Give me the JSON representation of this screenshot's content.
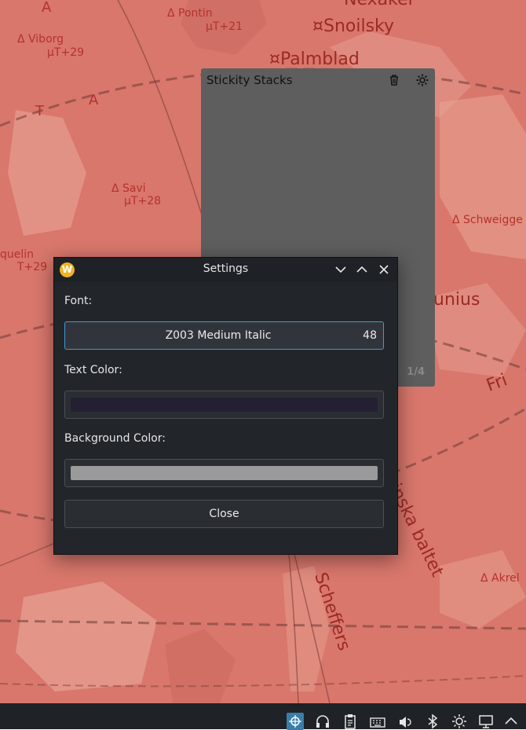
{
  "wallpaper": {
    "labels": [
      {
        "text": "A",
        "key": "a1"
      },
      {
        "text": "Δ Pontin",
        "key": "pontin"
      },
      {
        "text": "µT+21",
        "key": "pontin_t"
      },
      {
        "text": "¤Snoilsky",
        "key": "snoilsky"
      },
      {
        "text": "Nexakel",
        "key": "nexakel"
      },
      {
        "text": "Δ Viborg",
        "key": "viborg"
      },
      {
        "text": "µT+29",
        "key": "viborg_t"
      },
      {
        "text": "¤Palmblad",
        "key": "palmblad"
      },
      {
        "text": "T",
        "key": "t1"
      },
      {
        "text": "A",
        "key": "a2"
      },
      {
        "text": "Δ Savi",
        "key": "savi"
      },
      {
        "text": "µT+28",
        "key": "savi_t"
      },
      {
        "text": "Δ Schweigge",
        "key": "schweigge"
      },
      {
        "text": "quelin",
        "key": "quelin"
      },
      {
        "text": "T+29",
        "key": "quelin_t"
      },
      {
        "text": "unius",
        "key": "unius"
      },
      {
        "text": "Fri",
        "key": "fri"
      },
      {
        "text": "Δ Akrel",
        "key": "akrel"
      },
      {
        "text": "Scheffers",
        "key": "scheffers"
      },
      {
        "text": "inska baltet",
        "key": "baltet"
      }
    ]
  },
  "sticky": {
    "title": "Stickity Stacks",
    "page_indicator": "1/4",
    "icons": {
      "delete": "trash-icon",
      "settings": "gear-icon"
    }
  },
  "settings": {
    "title": "Settings",
    "font_label": "Font:",
    "font_name": "Z003 Medium Italic",
    "font_size": "48",
    "text_color_label": "Text Color:",
    "text_color": "#241f33",
    "background_color_label": "Background Color:",
    "background_color": "#9a9a9a",
    "close_label": "Close",
    "app_icon_letter": "W"
  },
  "taskbar": {
    "tray_icons": [
      "network-icon",
      "headset-icon",
      "clipboard-icon",
      "keyboard-icon",
      "volume-icon",
      "bluetooth-icon",
      "brightness-icon",
      "display-icon",
      "chevron-up-icon"
    ]
  }
}
